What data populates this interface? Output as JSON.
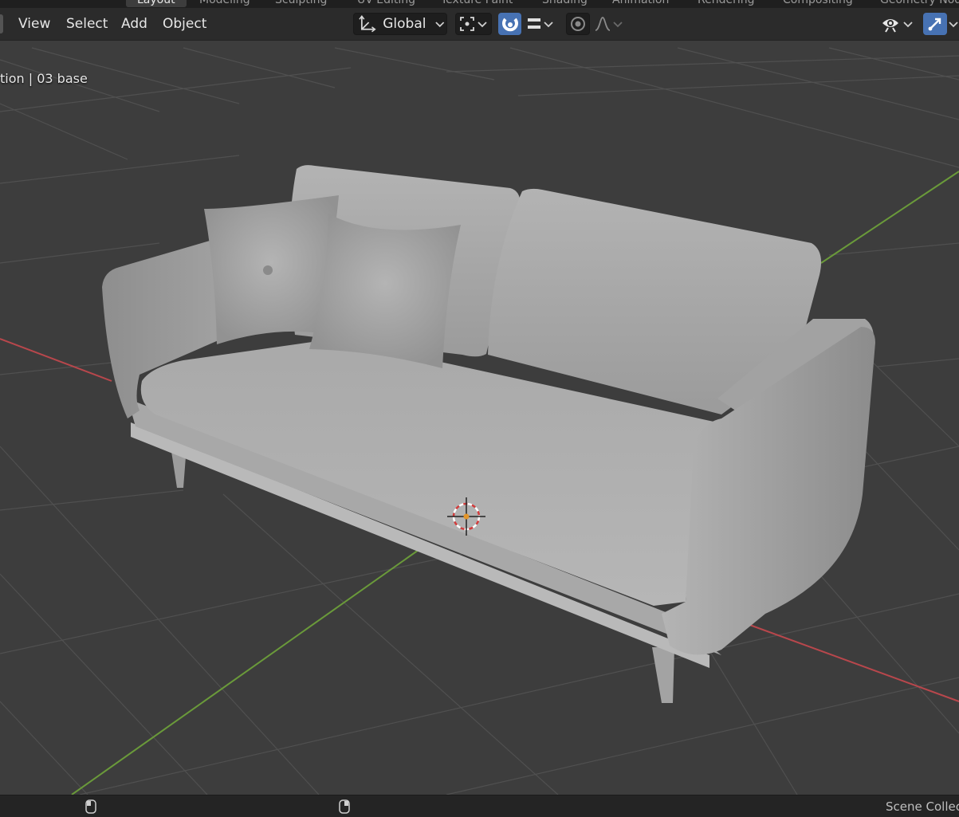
{
  "workspaces": {
    "tabs": [
      "Layout",
      "Modeling",
      "Sculpting",
      "UV Editing",
      "Texture Paint",
      "Shading",
      "Animation",
      "Rendering",
      "Compositing",
      "Geometry Nodes"
    ]
  },
  "header": {
    "menus": [
      "View",
      "Select",
      "Add",
      "Object"
    ],
    "transform_orientation": "Global",
    "icons": {
      "orientation": "transform-orientation-icon",
      "pivot": "pivot-point-icon",
      "snap": "snap-magnet-icon",
      "snap_target": "snap-increment-icon",
      "proportional": "proportional-editing-icon",
      "falloff": "falloff-curve-icon",
      "visibility": "visibility-eye-icon",
      "gizmo": "gizmo-toggle-icon"
    }
  },
  "viewport": {
    "overlay_title": "tion | 03 base",
    "object": "sofa-mesh",
    "colors": {
      "background": "#3d3d3d",
      "grid": "#505050",
      "x_axis": "#b8474c",
      "y_axis": "#6a9a3a",
      "mesh": "#a9a9a9"
    }
  },
  "statusbar": {
    "right_text": "Scene Collec"
  }
}
